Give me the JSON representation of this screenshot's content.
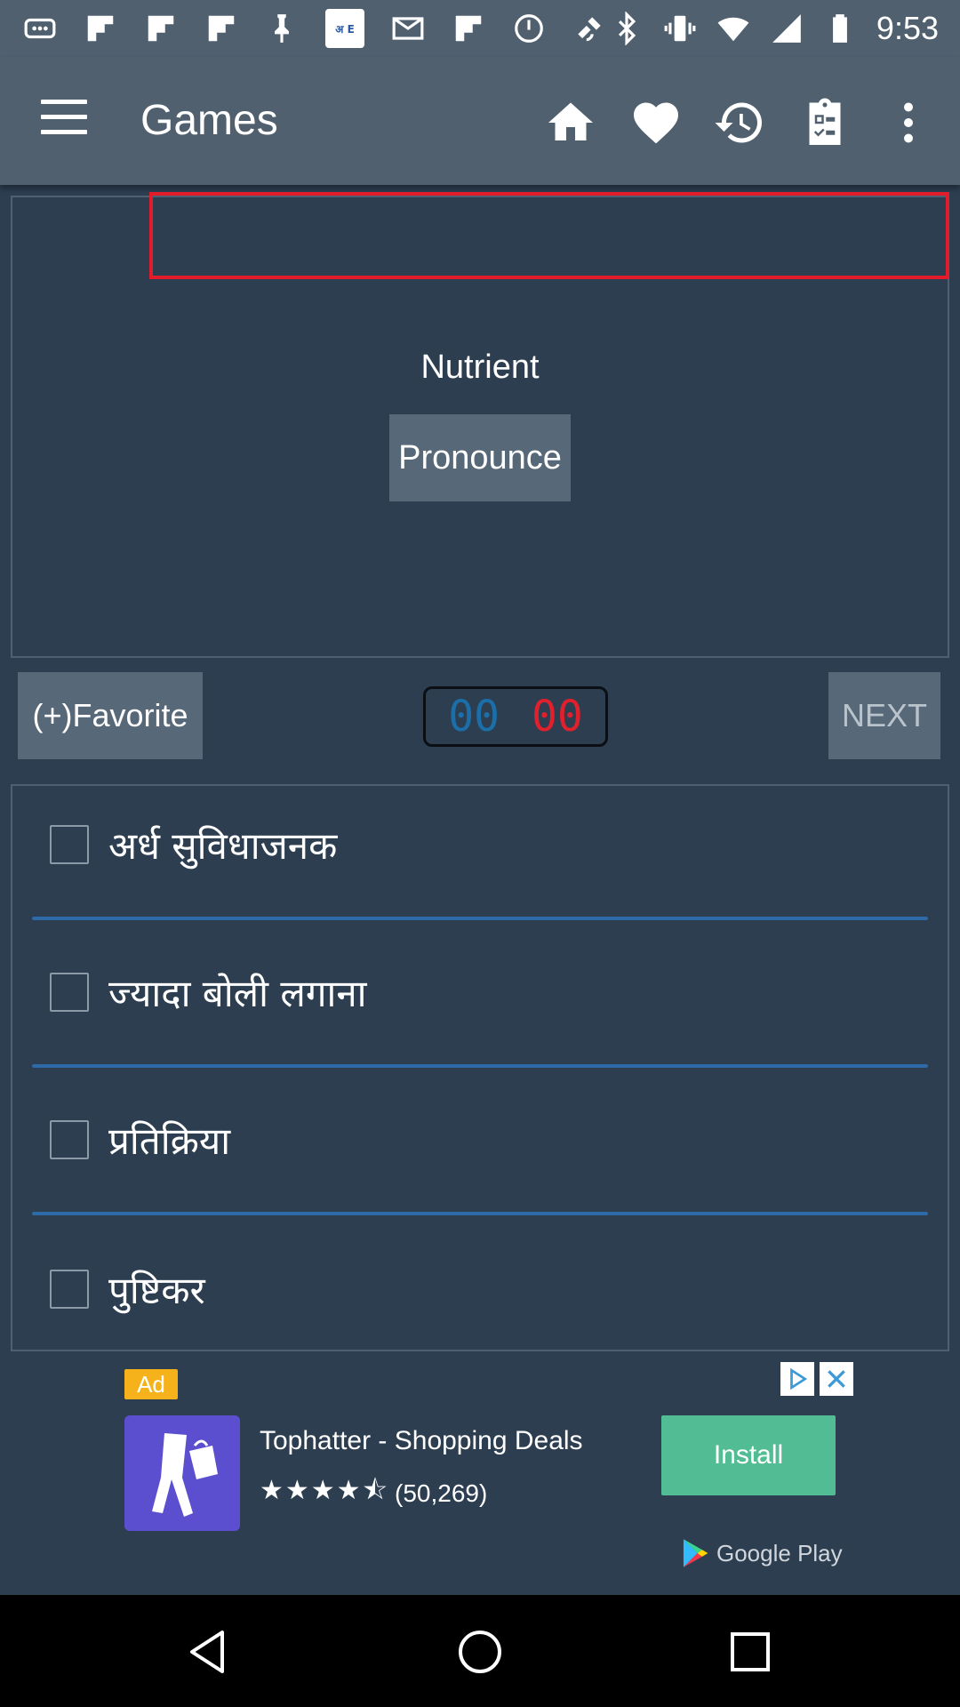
{
  "status_bar": {
    "time": "9:53",
    "left_icons": [
      "more-notifications-icon",
      "flipboard-icon",
      "flipboard-icon",
      "flipboard-icon",
      "pin-icon",
      "hindi-english-app-icon",
      "mail-icon",
      "flipboard-icon",
      "speed-icon",
      "fake-gps-icon"
    ],
    "app_icon_text": "अ E",
    "right_icons": [
      "bluetooth-icon",
      "vibrate-icon",
      "wifi-icon",
      "signal-icon",
      "battery-icon"
    ]
  },
  "appbar": {
    "title": "Games",
    "actions": [
      "home-icon",
      "heart-icon",
      "history-icon",
      "clipboard-icon",
      "overflow-menu-icon"
    ]
  },
  "question": {
    "word": "Nutrient",
    "pronounce_label": "Pronounce"
  },
  "controls": {
    "favorite_label": "(+)Favorite",
    "timer_minutes": "00",
    "timer_seconds": "00",
    "next_label": "NEXT"
  },
  "options": [
    {
      "label": "अर्ध सुविधाजनक",
      "checked": false
    },
    {
      "label": "ज्यादा बोली लगाना",
      "checked": false
    },
    {
      "label": "प्रतिक्रिया",
      "checked": false
    },
    {
      "label": "पुष्टिकर",
      "checked": false
    }
  ],
  "ad": {
    "badge": "Ad",
    "app_name": "Tophatter - Shopping Deals",
    "stars": "★★★★⯪",
    "rating_count": "(50,269)",
    "install_label": "Install",
    "store_label": "Google Play"
  },
  "colors": {
    "background": "#2c3e50",
    "appbar": "#50606f",
    "button": "#576878",
    "highlight_border": "#e21c2a",
    "divider": "#2f6aa8",
    "timer_minutes": "#1b6ea8",
    "timer_seconds": "#e0202c",
    "ad_install": "#52bd95",
    "ad_badge": "#f6b21a"
  }
}
